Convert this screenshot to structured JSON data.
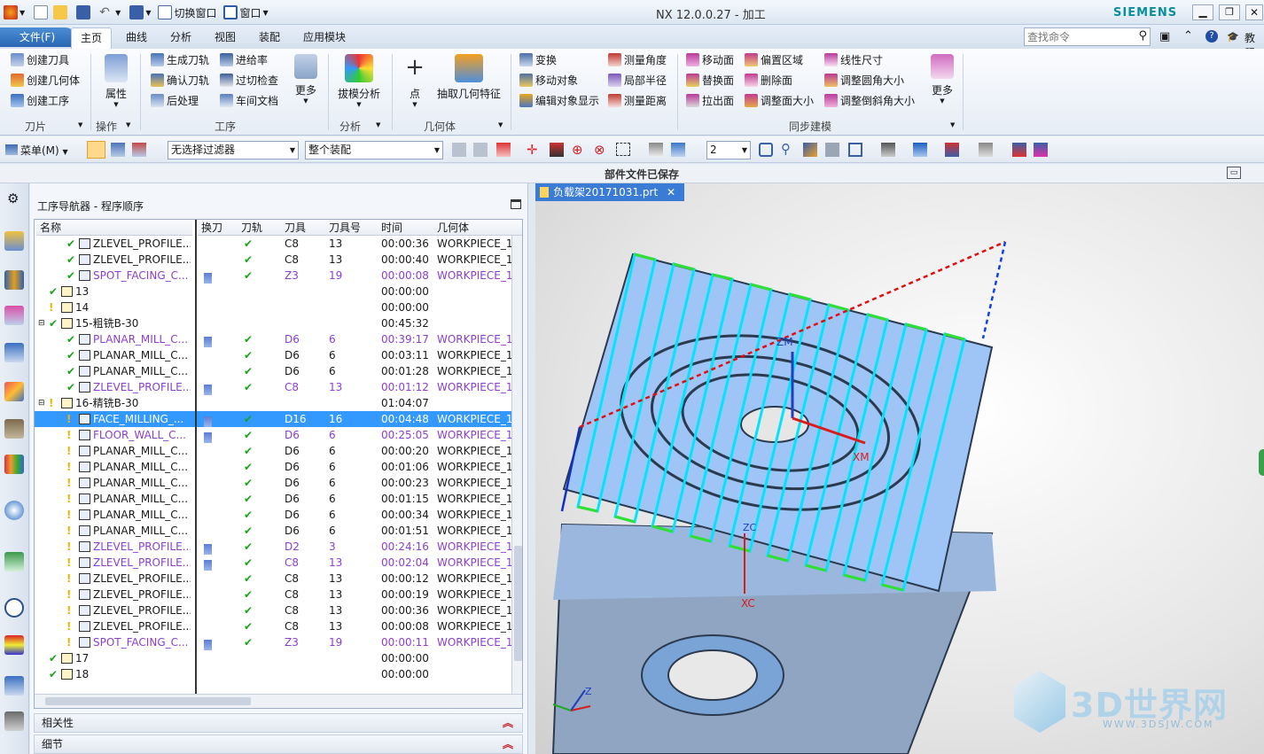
{
  "titlebar": {
    "title": "NX 12.0.0.27 - 加工",
    "brand": "SIEMENS",
    "switch_window": "切换窗口",
    "window_menu": "窗口"
  },
  "tabs": {
    "file": "文件(F)",
    "items": [
      "主页",
      "曲线",
      "分析",
      "视图",
      "装配",
      "应用模块"
    ]
  },
  "search": {
    "placeholder": "查找命令",
    "tutorial": "教程"
  },
  "ribbon": {
    "knife": {
      "items": [
        "创建刀具",
        "创建几何体",
        "创建工序"
      ],
      "label": "刀片"
    },
    "operation": {
      "big": "属性",
      "label": "操作"
    },
    "process": {
      "col1": [
        "生成刀轨",
        "确认刀轨",
        "后处理"
      ],
      "col2": [
        "进给率",
        "过切检查",
        "车间文档"
      ],
      "more": "更多",
      "label": "工序"
    },
    "analysis": {
      "big": "拔模分析",
      "label": "分析"
    },
    "geometry": {
      "point": "点",
      "extract": "抽取几何特征",
      "label": "几何体"
    },
    "transform": {
      "items": [
        "变换",
        "移动对象",
        "编辑对象显示"
      ]
    },
    "measure": {
      "items": [
        "测量角度",
        "局部半径",
        "测量距离"
      ]
    },
    "sync": {
      "col1": [
        "移动面",
        "替换面",
        "拉出面"
      ],
      "col2": [
        "偏置区域",
        "删除面",
        "调整面大小"
      ],
      "col3": [
        "线性尺寸",
        "调整圆角大小",
        "调整倒斜角大小"
      ],
      "more": "更多",
      "label": "同步建模"
    }
  },
  "toolbar2": {
    "menu": "菜单(M)",
    "filter": "无选择过滤器",
    "assembly": "整个装配",
    "number": "2"
  },
  "status": "部件文件已保存",
  "navigator": {
    "title": "工序导航器 - 程序顺序",
    "columns": [
      "名称",
      "换刀",
      "刀轨",
      "刀具",
      "刀具号",
      "时间",
      "几何体"
    ],
    "rows": [
      {
        "name": "ZLEVEL_PROFILE...",
        "change": "",
        "path": "✔",
        "tool": "C8",
        "num": "13",
        "time": "00:00:36",
        "geom": "WORKPIECE_1",
        "purple": false,
        "indent": 2,
        "icon": "z"
      },
      {
        "name": "ZLEVEL_PROFILE...",
        "change": "",
        "path": "✔",
        "tool": "C8",
        "num": "13",
        "time": "00:00:40",
        "geom": "WORKPIECE_1",
        "purple": false,
        "indent": 2,
        "icon": "z"
      },
      {
        "name": "SPOT_FACING_C...",
        "change": "t",
        "path": "✔",
        "tool": "Z3",
        "num": "19",
        "time": "00:00:08",
        "geom": "WORKPIECE_1",
        "purple": true,
        "indent": 2,
        "icon": "s"
      },
      {
        "name": "13",
        "change": "",
        "path": "",
        "tool": "",
        "num": "",
        "time": "00:00:00",
        "geom": "",
        "purple": false,
        "indent": 1,
        "icon": "f"
      },
      {
        "name": "14",
        "change": "",
        "path": "",
        "tool": "",
        "num": "",
        "time": "00:00:00",
        "geom": "",
        "purple": false,
        "indent": 1,
        "icon": "fy"
      },
      {
        "name": "15-粗铣B-30",
        "change": "",
        "path": "",
        "tool": "",
        "num": "",
        "time": "00:45:32",
        "geom": "",
        "purple": false,
        "indent": 1,
        "icon": "f"
      },
      {
        "name": "PLANAR_MILL_C...",
        "change": "t",
        "path": "✔",
        "tool": "D6",
        "num": "6",
        "time": "00:39:17",
        "geom": "WORKPIECE_1",
        "purple": true,
        "indent": 2,
        "icon": "p"
      },
      {
        "name": "PLANAR_MILL_C...",
        "change": "",
        "path": "✔",
        "tool": "D6",
        "num": "6",
        "time": "00:03:11",
        "geom": "WORKPIECE_1",
        "purple": false,
        "indent": 2,
        "icon": "p"
      },
      {
        "name": "PLANAR_MILL_C...",
        "change": "",
        "path": "✔",
        "tool": "D6",
        "num": "6",
        "time": "00:01:28",
        "geom": "WORKPIECE_1",
        "purple": false,
        "indent": 2,
        "icon": "p"
      },
      {
        "name": "ZLEVEL_PROFILE...",
        "change": "t",
        "path": "✔",
        "tool": "C8",
        "num": "13",
        "time": "00:01:12",
        "geom": "WORKPIECE_1",
        "purple": true,
        "indent": 2,
        "icon": "z"
      },
      {
        "name": "16-精铣B-30",
        "change": "",
        "path": "",
        "tool": "",
        "num": "",
        "time": "01:04:07",
        "geom": "",
        "purple": false,
        "indent": 1,
        "icon": "fy"
      },
      {
        "name": "FACE_MILLING_...",
        "change": "t",
        "path": "✔",
        "tool": "D16",
        "num": "16",
        "time": "00:04:48",
        "geom": "WORKPIECE_1",
        "purple": false,
        "indent": 2,
        "icon": "m",
        "selected": true
      },
      {
        "name": "FLOOR_WALL_C...",
        "change": "t",
        "path": "✔",
        "tool": "D6",
        "num": "6",
        "time": "00:25:05",
        "geom": "WORKPIECE_1",
        "purple": true,
        "indent": 2,
        "icon": "m"
      },
      {
        "name": "PLANAR_MILL_C...",
        "change": "",
        "path": "✔",
        "tool": "D6",
        "num": "6",
        "time": "00:00:20",
        "geom": "WORKPIECE_1",
        "purple": false,
        "indent": 2,
        "icon": "p"
      },
      {
        "name": "PLANAR_MILL_C...",
        "change": "",
        "path": "✔",
        "tool": "D6",
        "num": "6",
        "time": "00:01:06",
        "geom": "WORKPIECE_1",
        "purple": false,
        "indent": 2,
        "icon": "p"
      },
      {
        "name": "PLANAR_MILL_C...",
        "change": "",
        "path": "✔",
        "tool": "D6",
        "num": "6",
        "time": "00:00:23",
        "geom": "WORKPIECE_1",
        "purple": false,
        "indent": 2,
        "icon": "p"
      },
      {
        "name": "PLANAR_MILL_C...",
        "change": "",
        "path": "✔",
        "tool": "D6",
        "num": "6",
        "time": "00:01:15",
        "geom": "WORKPIECE_1",
        "purple": false,
        "indent": 2,
        "icon": "p"
      },
      {
        "name": "PLANAR_MILL_C...",
        "change": "",
        "path": "✔",
        "tool": "D6",
        "num": "6",
        "time": "00:00:34",
        "geom": "WORKPIECE_1",
        "purple": false,
        "indent": 2,
        "icon": "p"
      },
      {
        "name": "PLANAR_MILL_C...",
        "change": "",
        "path": "✔",
        "tool": "D6",
        "num": "6",
        "time": "00:01:51",
        "geom": "WORKPIECE_1",
        "purple": false,
        "indent": 2,
        "icon": "p"
      },
      {
        "name": "ZLEVEL_PROFILE...",
        "change": "t",
        "path": "✔",
        "tool": "D2",
        "num": "3",
        "time": "00:24:16",
        "geom": "WORKPIECE_1",
        "purple": true,
        "indent": 2,
        "icon": "z"
      },
      {
        "name": "ZLEVEL_PROFILE...",
        "change": "t",
        "path": "✔",
        "tool": "C8",
        "num": "13",
        "time": "00:02:04",
        "geom": "WORKPIECE_1",
        "purple": true,
        "indent": 2,
        "icon": "z"
      },
      {
        "name": "ZLEVEL_PROFILE...",
        "change": "",
        "path": "✔",
        "tool": "C8",
        "num": "13",
        "time": "00:00:12",
        "geom": "WORKPIECE_1",
        "purple": false,
        "indent": 2,
        "icon": "z"
      },
      {
        "name": "ZLEVEL_PROFILE...",
        "change": "",
        "path": "✔",
        "tool": "C8",
        "num": "13",
        "time": "00:00:19",
        "geom": "WORKPIECE_1",
        "purple": false,
        "indent": 2,
        "icon": "z"
      },
      {
        "name": "ZLEVEL_PROFILE...",
        "change": "",
        "path": "✔",
        "tool": "C8",
        "num": "13",
        "time": "00:00:36",
        "geom": "WORKPIECE_1",
        "purple": false,
        "indent": 2,
        "icon": "z"
      },
      {
        "name": "ZLEVEL_PROFILE...",
        "change": "",
        "path": "✔",
        "tool": "C8",
        "num": "13",
        "time": "00:00:08",
        "geom": "WORKPIECE_1",
        "purple": false,
        "indent": 2,
        "icon": "z"
      },
      {
        "name": "SPOT_FACING_C...",
        "change": "t",
        "path": "✔",
        "tool": "Z3",
        "num": "19",
        "time": "00:00:11",
        "geom": "WORKPIECE_1",
        "purple": true,
        "indent": 2,
        "icon": "s"
      },
      {
        "name": "17",
        "change": "",
        "path": "",
        "tool": "",
        "num": "",
        "time": "00:00:00",
        "geom": "",
        "purple": false,
        "indent": 1,
        "icon": "f"
      },
      {
        "name": "18",
        "change": "",
        "path": "",
        "tool": "",
        "num": "",
        "time": "00:00:00",
        "geom": "",
        "purple": false,
        "indent": 1,
        "icon": "f"
      }
    ]
  },
  "panels": {
    "relevance": "相关性",
    "details": "细节"
  },
  "viewport": {
    "tab": "负载架20171031.prt",
    "axis_labels": {
      "zm": "ZM",
      "xm": "XM",
      "zc": "ZC",
      "xc": "XC",
      "z": "Z"
    },
    "watermark": "3D世界网",
    "watermark_url": "WWW.3DSJW.COM"
  }
}
